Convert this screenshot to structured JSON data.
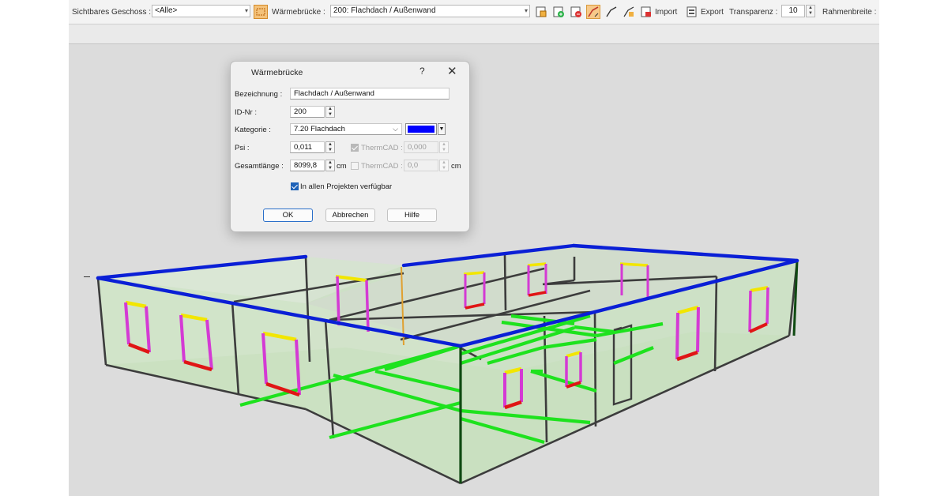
{
  "toolbar": {
    "floor_label": "Sichtbares Geschoss :",
    "floor_value": "<Alle>",
    "bridge_label": "Wärmebrücke :",
    "bridge_value": "200: Flachdach / Außenwand",
    "import_label": "Import",
    "export_label": "Export",
    "transparency_label": "Transparenz :",
    "transparency_value": "10",
    "frame_width_label": "Rahmenbreite :"
  },
  "dialog": {
    "title": "Wärmebrücke",
    "help_glyph": "?",
    "close_glyph": "✕",
    "designation_label": "Bezeichnung :",
    "designation_value": "Flachdach / Außenwand",
    "id_label": "ID-Nr :",
    "id_value": "200",
    "category_label": "Kategorie :",
    "category_value": "7.20 Flachdach",
    "category_color": "#0000ff",
    "psi_label": "Psi :",
    "psi_value": "0,011",
    "psi_thermcad_label": "ThermCAD :",
    "psi_thermcad_value": "0,000",
    "psi_thermcad_checked": true,
    "length_label": "Gesamtlänge :",
    "length_value": "8099,8",
    "length_unit": "cm",
    "length_thermcad_label": "ThermCAD :",
    "length_thermcad_value": "0,0",
    "length_thermcad_unit": "cm",
    "length_thermcad_checked": false,
    "all_projects_label": "In allen Projekten verfügbar",
    "all_projects_checked": true,
    "ok_label": "OK",
    "cancel_label": "Abbrechen",
    "help_label": "Hilfe"
  },
  "viewport": {
    "description_colors": {
      "highlighted_bridge": "#0a1fd6",
      "floor_bridge": "#22dd22",
      "window_lintel": "#f2e600",
      "window_sill": "#e01515",
      "window_reveal": "#d43ad4",
      "wall_fill": "#cfe7c7"
    }
  }
}
